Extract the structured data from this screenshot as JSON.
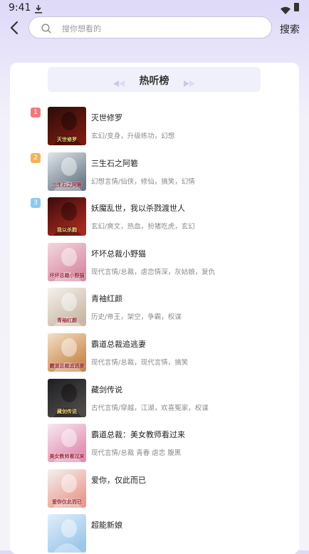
{
  "status_bar": {
    "time": "9:41"
  },
  "header": {
    "search_placeholder": "搜你想看的",
    "search_button": "搜索"
  },
  "ranking": {
    "title": "热听榜",
    "books": [
      {
        "rank": "1",
        "title": "灭世修罗",
        "tags": "玄幻/变身，升级练功，幻想",
        "cover_text": "灭世修罗",
        "cover_colors": [
          "#2a0e0a",
          "#7a1a10"
        ],
        "rank_color": "#f07a7a"
      },
      {
        "rank": "2",
        "title": "三生石之阿箬",
        "tags": "幻想言情/仙侠，修仙，搞笑，幻情",
        "cover_text": "三生石之阿箬",
        "cover_colors": [
          "#dfe6ec",
          "#6b7a88"
        ],
        "rank_color": "#f3b25a"
      },
      {
        "rank": "3",
        "title": "妖魔乱世，我以杀戮渡世人",
        "tags": "玄幻/爽文，热血，扮猪吃虎，玄幻",
        "cover_text": "我以杀戮",
        "cover_colors": [
          "#3a0c0c",
          "#a8281e"
        ],
        "rank_color": "#8ec8f0"
      },
      {
        "rank": "",
        "title": "坏坏总裁小野猫",
        "tags": "现代言情/总裁，虐恋情深，灰姑娘，复仇",
        "cover_text": "坏坏总裁小野猫",
        "cover_colors": [
          "#f3d8de",
          "#d88aa4"
        ],
        "rank_color": ""
      },
      {
        "rank": "",
        "title": "青袖红颜",
        "tags": "历史/帝王，架空，争霸，权谋",
        "cover_text": "青袖红颜",
        "cover_colors": [
          "#f5f1ec",
          "#c9b8a6"
        ],
        "rank_color": ""
      },
      {
        "rank": "",
        "title": "霸道总裁追逃妻",
        "tags": "现代言情/总裁，现代言情，搞笑",
        "cover_text": "霸道总裁追逃妻",
        "cover_colors": [
          "#f1e0c6",
          "#c9854a"
        ],
        "rank_color": ""
      },
      {
        "rank": "",
        "title": "藏剑传说",
        "tags": "古代言情/穿越，江湖，欢喜冤家，权谋",
        "cover_text": "藏剑传说",
        "cover_colors": [
          "#1e1e22",
          "#4e4a48"
        ],
        "rank_color": ""
      },
      {
        "rank": "",
        "title": "霸道总裁：美女教师看过来",
        "tags": "现代言情/总裁 青春 虐恋 腹黑",
        "cover_text": "美女教师看过来",
        "cover_colors": [
          "#f6eaf0",
          "#e28ab0"
        ],
        "rank_color": ""
      },
      {
        "rank": "",
        "title": "爱你，仅此而已",
        "tags": "",
        "cover_text": "爱你仅此而已",
        "cover_colors": [
          "#f4f1ef",
          "#e89a8e"
        ],
        "rank_color": ""
      },
      {
        "rank": "",
        "title": "超能新娘",
        "tags": "",
        "cover_text": "",
        "cover_colors": [
          "#dfeefc",
          "#9cc6ea"
        ],
        "rank_color": ""
      }
    ]
  }
}
